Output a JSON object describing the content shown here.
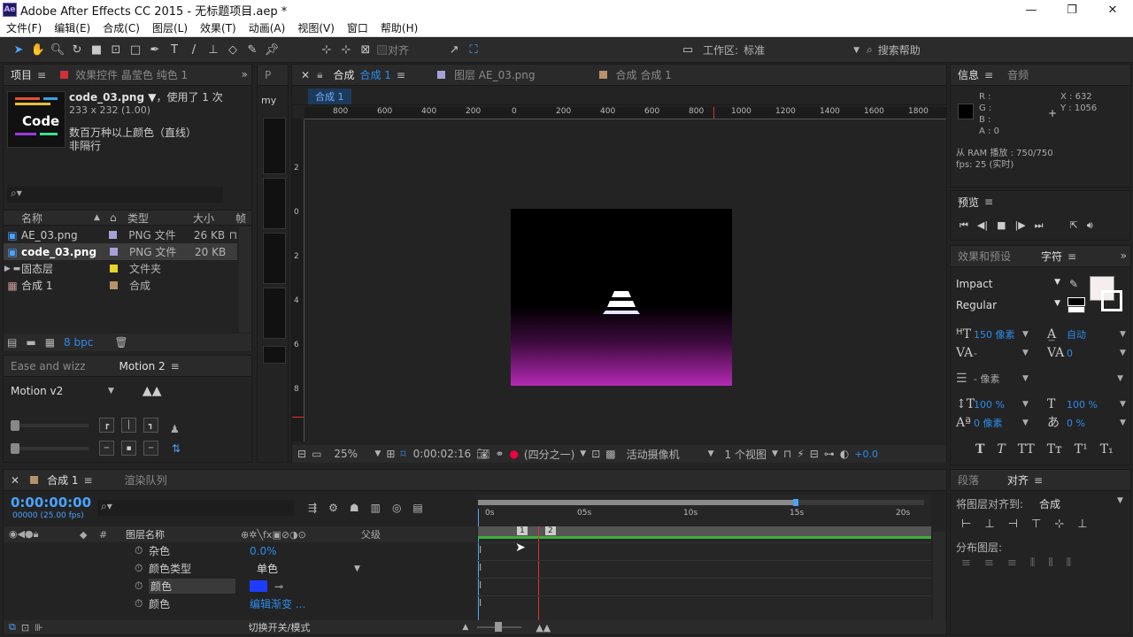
{
  "window": {
    "title": "Adobe After Effects CC 2015 - 无标题项目.aep *",
    "logo": "Ae"
  },
  "menu": [
    "文件(F)",
    "编辑(E)",
    "合成(C)",
    "图层(L)",
    "效果(T)",
    "动画(A)",
    "视图(V)",
    "窗口",
    "帮助(H)"
  ],
  "toolbar": {
    "align_label": "对齐",
    "workspace_label": "工作区:",
    "workspace_value": "标准",
    "search_placeholder": "搜索帮助"
  },
  "project": {
    "tab1": "项目",
    "tab2": "效果控件 晶莹色 纯色 1",
    "tab3": "P",
    "thumb_text": "Code",
    "file": "code_03.png ▼",
    "usage": "，使用了 1 次",
    "dims": "233 x 232 (1.00)",
    "colors": "数百万种以上颜色（直线）",
    "interlace": "非隔行",
    "cols": {
      "name": "名称",
      "type": "类型",
      "size": "大小",
      "fps": "帧"
    },
    "items": [
      {
        "name": "AE_03.png",
        "type": "PNG 文件",
        "size": "26 KB",
        "color": "#a6a0d8"
      },
      {
        "name": "code_03.png",
        "type": "PNG 文件",
        "size": "20 KB",
        "color": "#a6a0d8"
      },
      {
        "name": "固态层",
        "type": "文件夹",
        "size": "",
        "color": "#e8d42a"
      },
      {
        "name": "合成 1",
        "type": "合成",
        "size": "",
        "color": "#b8916a"
      }
    ],
    "bpc": "8 bpc"
  },
  "motion": {
    "tab1": "Ease and wizz",
    "tab2": "Motion 2",
    "preset": "Motion v2"
  },
  "viewer": {
    "tab_comp": "合成",
    "tab_comp_name": "合成 1",
    "tab_layer": "图层 AE_03.png",
    "tab_comp2": "合成 合成 1",
    "breadcrumb": "合成 1",
    "side_label": "my",
    "ruler": [
      "800",
      "600",
      "400",
      "200",
      "0",
      "200",
      "400",
      "600",
      "800",
      "1000",
      "1200",
      "1400",
      "1600",
      "1800"
    ],
    "vruler": [
      "2",
      "0",
      "2",
      "4",
      "6",
      "8"
    ],
    "zoom": "25%",
    "timecode": "0:00:02:16",
    "quality": "(四分之一)",
    "camera": "活动摄像机",
    "views": "1 个视图",
    "exposure": "+0.0"
  },
  "info": {
    "tab1": "信息",
    "tab2": "音频",
    "r": "R :",
    "g": "G :",
    "b": "B :",
    "a": "A : 0",
    "x": "X : 632",
    "y": "Y : 1056",
    "ram": "从 RAM 播放 : 750/750",
    "fps": "fps: 25 (实时)"
  },
  "preview": {
    "title": "预览"
  },
  "character": {
    "tab1": "效果和预设",
    "tab2": "字符",
    "font": "Impact",
    "style": "Regular",
    "size": "150 像素",
    "leading": "自动",
    "tracking": "0",
    "kerning": "-",
    "stroke_w": "- 像素",
    "vscale": "100 %",
    "hscale": "100 %",
    "baseline": "0 像素",
    "tsume": "0 %"
  },
  "align": {
    "tab1": "段落",
    "tab2": "对齐",
    "align_to": "将图层对齐到:",
    "align_target": "合成",
    "distribute": "分布图层:"
  },
  "timeline": {
    "tab1": "合成 1",
    "tab2": "渲染队列",
    "timecode": "0:00:00:00",
    "frame": "00000 (25.00 fps)",
    "col_name": "图层名称",
    "col_parent": "父级",
    "toggle": "切换开关/模式",
    "ticks": [
      "0s",
      "05s",
      "10s",
      "15s",
      "20s"
    ],
    "props": [
      {
        "name": "杂色",
        "value": "0.0%"
      },
      {
        "name": "颜色类型",
        "value": "单色"
      },
      {
        "name": "颜色",
        "value": ""
      },
      {
        "name": "颜色",
        "value": "编辑渐变 ..."
      }
    ],
    "layer1": "1",
    "layer2": "2",
    "swatch": "#1e3cff"
  }
}
